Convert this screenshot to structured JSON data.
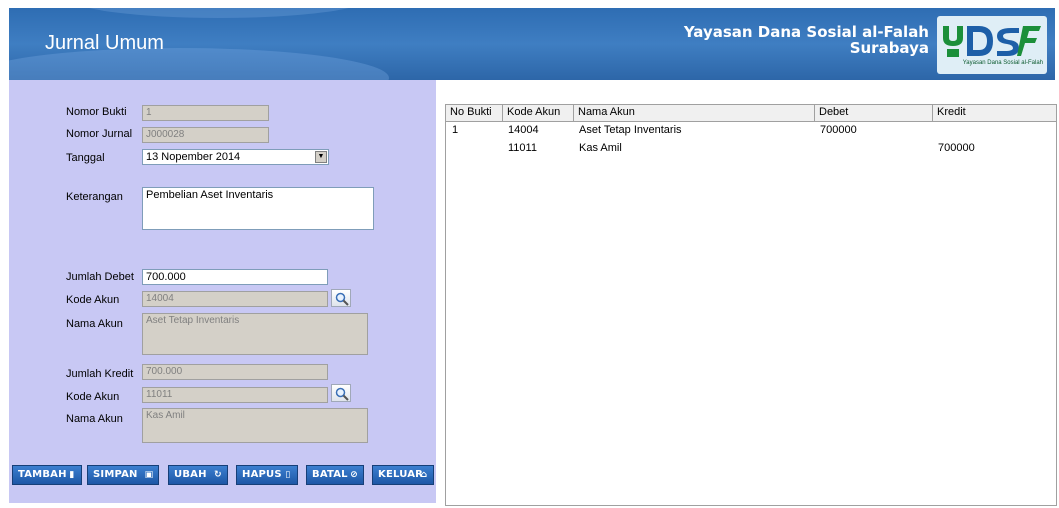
{
  "header": {
    "title": "Jurnal Umum",
    "org_line1": "Yayasan Dana Sosial al-Falah",
    "org_line2": "Surabaya",
    "logo_text": "YDSF",
    "logo_sub": "Yayasan Dana Sosial al-Falah",
    "bg_color": "#3b77bd"
  },
  "form": {
    "nomor_bukti_label": "Nomor Bukti",
    "nomor_bukti_value": "1",
    "nomor_jurnal_label": "Nomor Jurnal",
    "nomor_jurnal_value": "J000028",
    "tanggal_label": "Tanggal",
    "tanggal_value": "13 Nopember 2014",
    "keterangan_label": "Keterangan",
    "keterangan_value": "Pembelian Aset Inventaris",
    "jumlah_debet_label": "Jumlah Debet",
    "jumlah_debet_value": "700.000",
    "kode_akun_debet_label": "Kode Akun",
    "kode_akun_debet_value": "14004",
    "nama_akun_debet_label": "Nama Akun",
    "nama_akun_debet_value": "Aset Tetap Inventaris",
    "jumlah_kredit_label": "Jumlah Kredit",
    "jumlah_kredit_value": "700.000",
    "kode_akun_kredit_label": "Kode Akun",
    "kode_akun_kredit_value": "11011",
    "nama_akun_kredit_label": "Nama Akun",
    "nama_akun_kredit_value": "Kas Amil",
    "panel_color": "#c8c8f4"
  },
  "buttons": {
    "tambah": "TAMBAH",
    "simpan": "SIMPAN",
    "ubah": "UBAH",
    "hapus": "HAPUS",
    "batal": "BATAL",
    "keluar": "KELUAR"
  },
  "table": {
    "columns": [
      "No Bukti",
      "Kode Akun",
      "Nama Akun",
      "Debet",
      "Kredit"
    ],
    "rows": [
      {
        "no_bukti": "1",
        "kode_akun": "14004",
        "nama_akun": "Aset Tetap Inventaris",
        "debet": "700000",
        "kredit": ""
      },
      {
        "no_bukti": "",
        "kode_akun": "11011",
        "nama_akun": "Kas Amil",
        "debet": "",
        "kredit": "700000"
      }
    ]
  }
}
